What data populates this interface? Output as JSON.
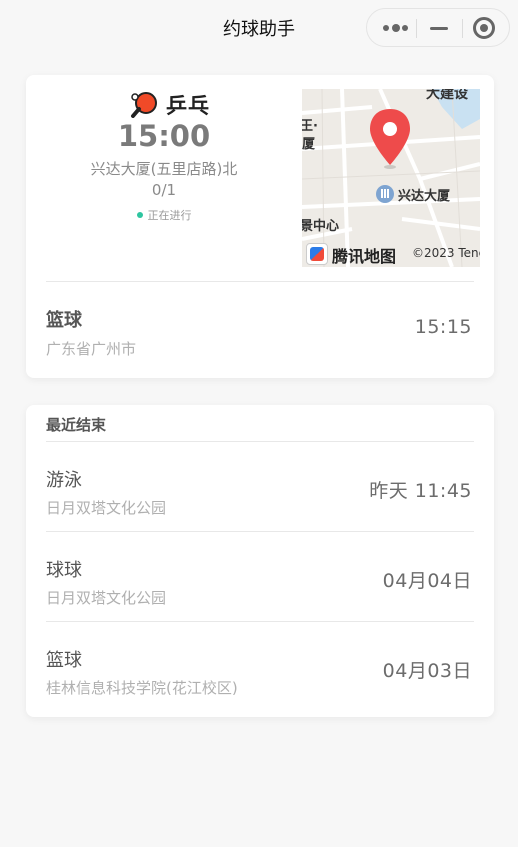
{
  "navbar": {
    "title": "约球助手",
    "more_icon": "more-dots-icon",
    "minimize_icon": "minimize-icon",
    "close_icon": "target-close-icon"
  },
  "current_event": {
    "sport_icon": "ping-pong-paddle-icon",
    "sport": "乒乓",
    "time": "15:00",
    "address": "兴达大厦(五里店路)北",
    "count": "0/1",
    "status": "正在进行",
    "status_color": "#2ec5a0",
    "map": {
      "labels": [
        "兴达大厦",
        "厦",
        "景中心",
        "大建设",
        "王·"
      ],
      "logo_text": "腾讯地图",
      "copyright": "©2023 Tenc",
      "pin_color": "#ee4b4b"
    }
  },
  "upcoming": {
    "title": "篮球",
    "location": "广东省广州市",
    "time": "15:15"
  },
  "recent": {
    "section_title": "最近结束",
    "items": [
      {
        "title": "游泳",
        "location": "日月双塔文化公园",
        "time": "昨天 11:45"
      },
      {
        "title": "球球",
        "location": "日月双塔文化公园",
        "time": "04月04日"
      },
      {
        "title": "篮球",
        "location": "桂林信息科技学院(花江校区)",
        "time": "04月03日"
      }
    ]
  }
}
